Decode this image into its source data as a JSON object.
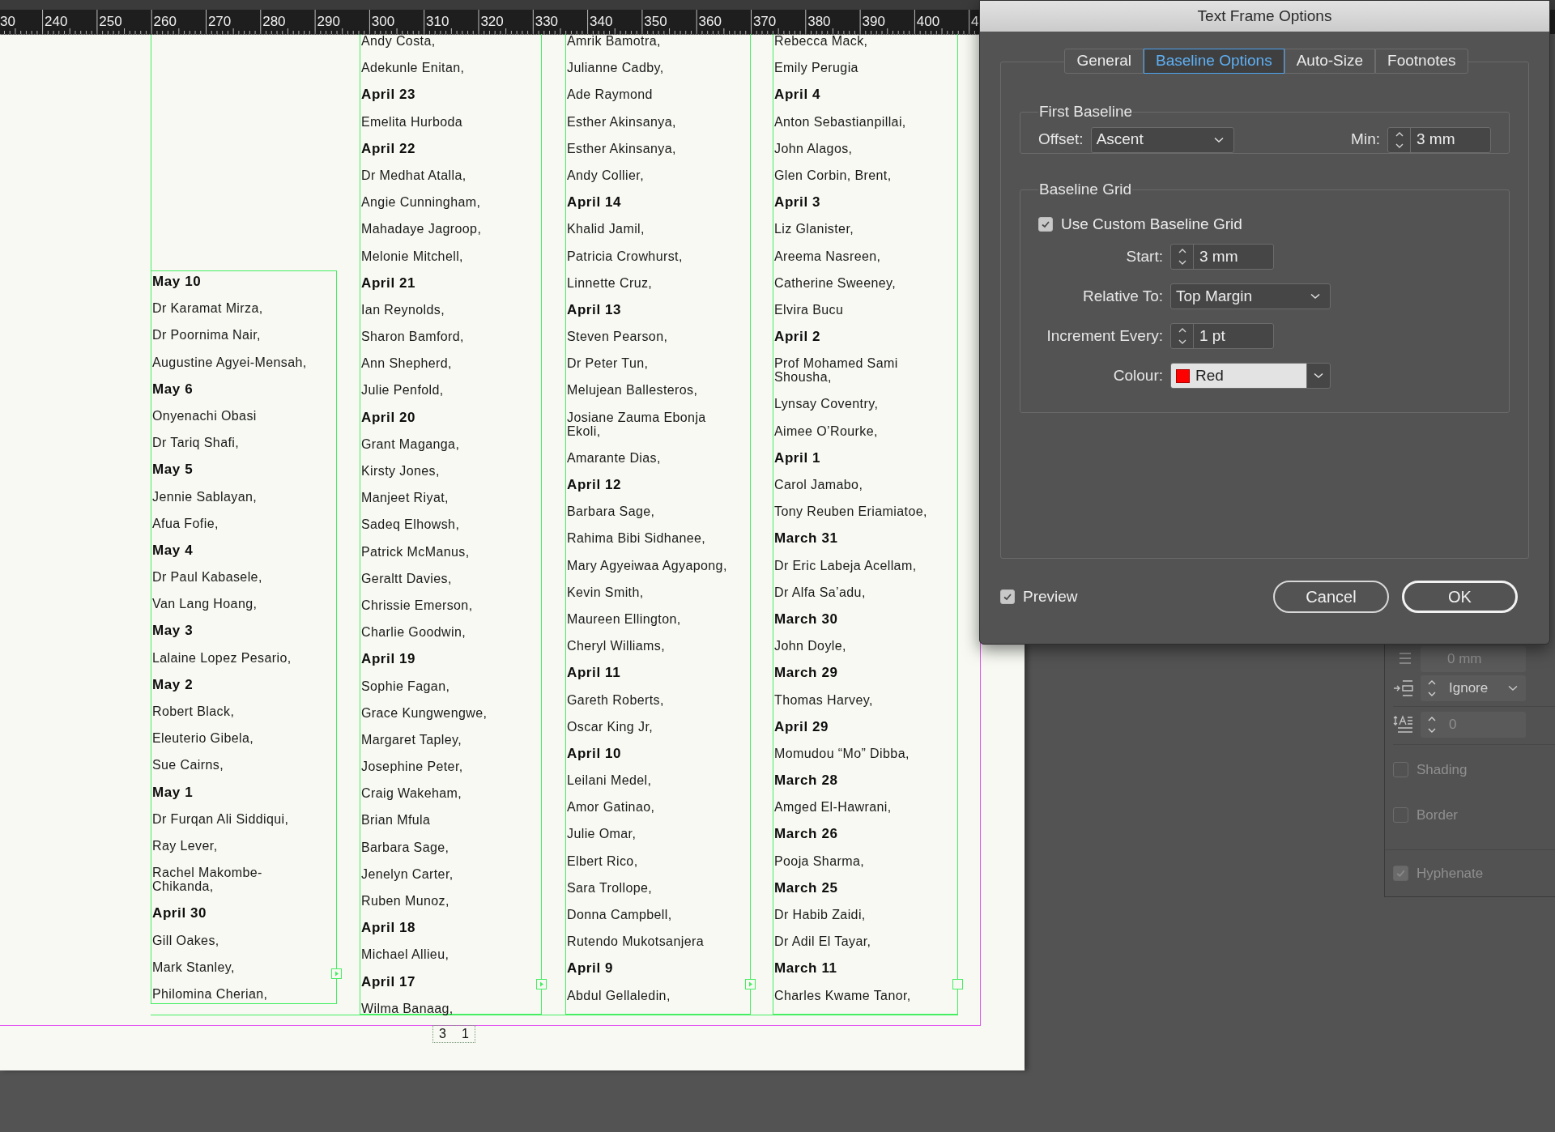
{
  "ruler": {
    "labels": [
      "30",
      "240",
      "250",
      "260",
      "270",
      "280",
      "290",
      "300",
      "310",
      "320",
      "330",
      "340",
      "350",
      "360",
      "370",
      "380",
      "390",
      "400",
      "4"
    ]
  },
  "document": {
    "frames": [
      {
        "entries": [
          {
            "kind": "date",
            "text": "May 10"
          },
          {
            "kind": "name",
            "text": "Dr Karamat Mirza,"
          },
          {
            "kind": "name",
            "text": "Dr Poornima Nair,"
          },
          {
            "kind": "name",
            "text": "Augustine Agyei-Mensah,"
          },
          {
            "kind": "date",
            "text": "May 6"
          },
          {
            "kind": "name",
            "text": "Onyenachi Obasi"
          },
          {
            "kind": "name",
            "text": "Dr Tariq Shafi,"
          },
          {
            "kind": "date",
            "text": "May 5"
          },
          {
            "kind": "name",
            "text": "Jennie Sablayan,"
          },
          {
            "kind": "name",
            "text": "Afua Fofie,"
          },
          {
            "kind": "date",
            "text": "May 4"
          },
          {
            "kind": "name",
            "text": "Dr Paul Kabasele,"
          },
          {
            "kind": "name",
            "text": "Van Lang Hoang,"
          },
          {
            "kind": "date",
            "text": "May 3"
          },
          {
            "kind": "name",
            "text": "Lalaine Lopez Pesario,"
          },
          {
            "kind": "date",
            "text": "May 2"
          },
          {
            "kind": "name",
            "text": "Robert Black,"
          },
          {
            "kind": "name",
            "text": "Eleuterio Gibela,"
          },
          {
            "kind": "name",
            "text": "Sue Cairns,"
          },
          {
            "kind": "date",
            "text": "May 1"
          },
          {
            "kind": "name",
            "text": "Dr Furqan Ali Siddiqui,"
          },
          {
            "kind": "name",
            "text": "Ray Lever,"
          },
          {
            "kind": "name",
            "text": "Rachel Makombe-\nChikanda,"
          },
          {
            "kind": "date",
            "text": "April 30"
          },
          {
            "kind": "name",
            "text": "Gill Oakes,"
          },
          {
            "kind": "name",
            "text": "Mark Stanley,"
          },
          {
            "kind": "name",
            "text": "Philomina Cherian,"
          }
        ]
      },
      {
        "entries": [
          {
            "kind": "name",
            "text": "Andy Costa,"
          },
          {
            "kind": "name",
            "text": "Adekunle Enitan,"
          },
          {
            "kind": "date",
            "text": "April 23"
          },
          {
            "kind": "name",
            "text": "Emelita Hurboda"
          },
          {
            "kind": "date",
            "text": "April 22"
          },
          {
            "kind": "name",
            "text": "Dr Medhat Atalla,"
          },
          {
            "kind": "name",
            "text": "Angie Cunningham,"
          },
          {
            "kind": "name",
            "text": "Mahadaye Jagroop,"
          },
          {
            "kind": "name",
            "text": "Melonie Mitchell,"
          },
          {
            "kind": "date",
            "text": "April 21"
          },
          {
            "kind": "name",
            "text": "Ian Reynolds,"
          },
          {
            "kind": "name",
            "text": "Sharon Bamford,"
          },
          {
            "kind": "name",
            "text": "Ann Shepherd,"
          },
          {
            "kind": "name",
            "text": "Julie Penfold,"
          },
          {
            "kind": "date",
            "text": "April 20"
          },
          {
            "kind": "name",
            "text": "Grant Maganga,"
          },
          {
            "kind": "name",
            "text": "Kirsty Jones,"
          },
          {
            "kind": "name",
            "text": "Manjeet Riyat,"
          },
          {
            "kind": "name",
            "text": "Sadeq Elhowsh,"
          },
          {
            "kind": "name",
            "text": "Patrick McManus,"
          },
          {
            "kind": "name",
            "text": "Geraltt Davies,"
          },
          {
            "kind": "name",
            "text": "Chrissie Emerson,"
          },
          {
            "kind": "name",
            "text": "Charlie Goodwin,"
          },
          {
            "kind": "date",
            "text": "April 19"
          },
          {
            "kind": "name",
            "text": "Sophie Fagan,"
          },
          {
            "kind": "name",
            "text": "Grace Kungwengwe,"
          },
          {
            "kind": "name",
            "text": "Margaret Tapley,"
          },
          {
            "kind": "name",
            "text": "Josephine Peter,"
          },
          {
            "kind": "name",
            "text": "Craig Wakeham,"
          },
          {
            "kind": "name",
            "text": "Brian Mfula"
          },
          {
            "kind": "name",
            "text": "Barbara Sage,"
          },
          {
            "kind": "name",
            "text": "Jenelyn Carter,"
          },
          {
            "kind": "name",
            "text": "Ruben Munoz,"
          },
          {
            "kind": "date",
            "text": "April 18"
          },
          {
            "kind": "name",
            "text": "Michael Allieu,"
          },
          {
            "kind": "date",
            "text": "April 17"
          },
          {
            "kind": "name",
            "text": "Wilma Banaag,"
          }
        ]
      },
      {
        "entries": [
          {
            "kind": "name",
            "text": "Amrik Bamotra,"
          },
          {
            "kind": "name",
            "text": "Julianne Cadby,"
          },
          {
            "kind": "name",
            "text": "Ade Raymond"
          },
          {
            "kind": "name",
            "text": "Esther Akinsanya,"
          },
          {
            "kind": "name",
            "text": "Esther Akinsanya,"
          },
          {
            "kind": "name",
            "text": "Andy Collier,"
          },
          {
            "kind": "date",
            "text": "April 14"
          },
          {
            "kind": "name",
            "text": "Khalid Jamil,"
          },
          {
            "kind": "name",
            "text": "Patricia Crowhurst,"
          },
          {
            "kind": "name",
            "text": "Linnette Cruz,"
          },
          {
            "kind": "date",
            "text": "April 13"
          },
          {
            "kind": "name",
            "text": "Steven Pearson,"
          },
          {
            "kind": "name",
            "text": "Dr Peter Tun,"
          },
          {
            "kind": "name",
            "text": "Melujean Ballesteros,"
          },
          {
            "kind": "name",
            "text": "Josiane Zauma Ebonja\nEkoli,"
          },
          {
            "kind": "name",
            "text": "Amarante Dias,"
          },
          {
            "kind": "date",
            "text": "April 12"
          },
          {
            "kind": "name",
            "text": "Barbara Sage,"
          },
          {
            "kind": "name",
            "text": "Rahima Bibi Sidhanee,"
          },
          {
            "kind": "name",
            "text": "Mary Agyeiwaa Agyapong,"
          },
          {
            "kind": "name",
            "text": "Kevin Smith,"
          },
          {
            "kind": "name",
            "text": "Maureen Ellington,"
          },
          {
            "kind": "name",
            "text": "Cheryl Williams,"
          },
          {
            "kind": "date",
            "text": "April 11"
          },
          {
            "kind": "name",
            "text": "Gareth Roberts,"
          },
          {
            "kind": "name",
            "text": "Oscar King Jr,"
          },
          {
            "kind": "date",
            "text": "April 10"
          },
          {
            "kind": "name",
            "text": "Leilani Medel,"
          },
          {
            "kind": "name",
            "text": "Amor Gatinao,"
          },
          {
            "kind": "name",
            "text": "Julie Omar,"
          },
          {
            "kind": "name",
            "text": "Elbert Rico,"
          },
          {
            "kind": "name",
            "text": "Sara Trollope,"
          },
          {
            "kind": "name",
            "text": "Donna Campbell,"
          },
          {
            "kind": "name",
            "text": "Rutendo Mukotsanjera"
          },
          {
            "kind": "date",
            "text": "April 9"
          },
          {
            "kind": "name",
            "text": "Abdul Gellaledin,"
          }
        ]
      },
      {
        "entries": [
          {
            "kind": "name",
            "text": "Rebecca Mack,"
          },
          {
            "kind": "name",
            "text": "Emily Perugia"
          },
          {
            "kind": "date",
            "text": "April 4"
          },
          {
            "kind": "name",
            "text": "Anton Sebastianpillai,"
          },
          {
            "kind": "name",
            "text": "John Alagos,"
          },
          {
            "kind": "name",
            "text": "Glen Corbin, Brent,"
          },
          {
            "kind": "date",
            "text": "April 3"
          },
          {
            "kind": "name",
            "text": "Liz Glanister,"
          },
          {
            "kind": "name",
            "text": "Areema Nasreen,"
          },
          {
            "kind": "name",
            "text": "Catherine Sweeney,"
          },
          {
            "kind": "name",
            "text": "Elvira Bucu"
          },
          {
            "kind": "date",
            "text": "April 2"
          },
          {
            "kind": "name",
            "text": "Prof Mohamed Sami\nShousha,"
          },
          {
            "kind": "name",
            "text": "Lynsay Coventry,"
          },
          {
            "kind": "name",
            "text": "Aimee O’Rourke,"
          },
          {
            "kind": "date",
            "text": "April 1"
          },
          {
            "kind": "name",
            "text": "Carol Jamabo,"
          },
          {
            "kind": "name",
            "text": "Tony Reuben Eriamiatoe,"
          },
          {
            "kind": "date",
            "text": "March 31"
          },
          {
            "kind": "name",
            "text": "Dr Eric Labeja Acellam,"
          },
          {
            "kind": "name",
            "text": "Dr Alfa Sa’adu,"
          },
          {
            "kind": "date",
            "text": "March 30"
          },
          {
            "kind": "name",
            "text": "John Doyle,"
          },
          {
            "kind": "date",
            "text": "March 29"
          },
          {
            "kind": "name",
            "text": "Thomas Harvey,"
          },
          {
            "kind": "date",
            "text": "April 29"
          },
          {
            "kind": "name",
            "text": "Momudou “Mo” Dibba,"
          },
          {
            "kind": "date",
            "text": "March 28"
          },
          {
            "kind": "name",
            "text": "Amged El-Hawrani,"
          },
          {
            "kind": "date",
            "text": "March 26"
          },
          {
            "kind": "name",
            "text": "Pooja Sharma,"
          },
          {
            "kind": "date",
            "text": "March 25"
          },
          {
            "kind": "name",
            "text": "Dr Habib Zaidi,"
          },
          {
            "kind": "name",
            "text": "Dr Adil El Tayar,"
          },
          {
            "kind": "date",
            "text": "March 11"
          },
          {
            "kind": "name",
            "text": "Charles Kwame Tanor,"
          }
        ]
      }
    ],
    "page_number": [
      "3",
      "1"
    ]
  },
  "dialog": {
    "title": "Text Frame Options",
    "tabs": [
      {
        "label": "General",
        "selected": false
      },
      {
        "label": "Baseline Options",
        "selected": true
      },
      {
        "label": "Auto-Size",
        "selected": false
      },
      {
        "label": "Footnotes",
        "selected": false
      }
    ],
    "first_baseline": {
      "heading": "First Baseline",
      "offset_label": "Offset:",
      "offset_value": "Ascent",
      "min_label": "Min:",
      "min_value": "3 mm"
    },
    "baseline_grid": {
      "heading": "Baseline Grid",
      "use_custom": {
        "label": "Use Custom Baseline Grid",
        "checked": true
      },
      "start_label": "Start:",
      "start_value": "3 mm",
      "relative_label": "Relative To:",
      "relative_value": "Top Margin",
      "increment_label": "Increment Every:",
      "increment_value": "1 pt",
      "colour_label": "Colour:",
      "colour_value": "Red"
    },
    "preview": {
      "label": "Preview",
      "checked": true
    },
    "buttons": [
      "Cancel",
      "OK"
    ]
  },
  "panel": {
    "spacing_value": "0 mm",
    "align_value": "Ignore",
    "number_value": "0",
    "options": [
      {
        "label": "Shading",
        "checked": false
      },
      {
        "label": "Border",
        "checked": false
      },
      {
        "label": "Hyphenate",
        "checked": true
      }
    ]
  }
}
